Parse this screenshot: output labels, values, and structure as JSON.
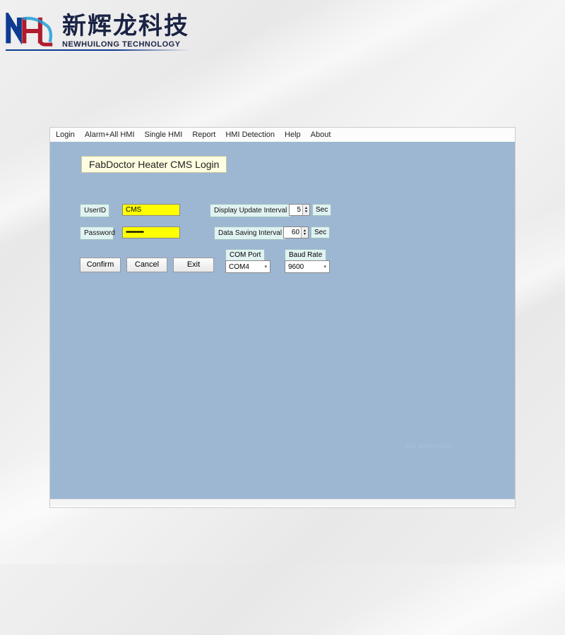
{
  "brand": {
    "company_cn": "新辉龙科技",
    "company_en": "NEWHUILONG TECHNOLOGY"
  },
  "menu": {
    "items": [
      "Login",
      "Alarm+All HMI",
      "Single HMI",
      "Report",
      "HMI Detection",
      "Help",
      "About"
    ]
  },
  "login": {
    "title": "FabDoctor Heater CMS Login",
    "userid_label": "UserID",
    "userid_value": "CMS",
    "password_label": "Password",
    "password_value": "••••••••••",
    "display_interval_label": "Display Update Interval",
    "display_interval_value": "5",
    "display_interval_unit": "Sec",
    "saving_interval_label": "Data Saving Interval",
    "saving_interval_value": "60",
    "saving_interval_unit": "Sec",
    "confirm_label": "Confirm",
    "cancel_label": "Cancel",
    "exit_label": "Exit",
    "com_port_label": "COM Port",
    "com_port_value": "COM4",
    "baud_rate_label": "Baud Rate",
    "baud_rate_value": "9600"
  },
  "watermark": "Full screen Snip"
}
